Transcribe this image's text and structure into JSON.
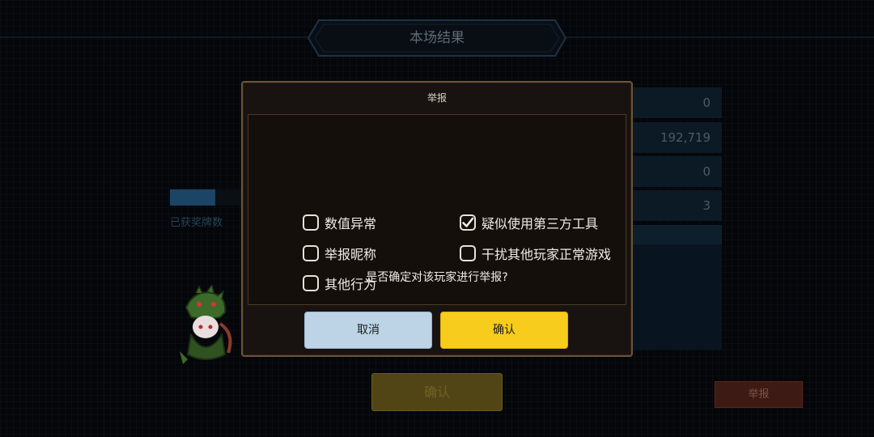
{
  "header": {
    "title": "本场结果"
  },
  "stats": {
    "values": [
      "0",
      "192,719",
      "0",
      "3"
    ]
  },
  "medals": {
    "label": "已获奖牌数",
    "progress": 0.62
  },
  "background_buttons": {
    "confirm_label": "确认",
    "report_label": "举报"
  },
  "dialog": {
    "title": "举报",
    "options": [
      {
        "label": "数值异常",
        "checked": false
      },
      {
        "label": "疑似使用第三方工具",
        "checked": true
      },
      {
        "label": "举报昵称",
        "checked": false
      },
      {
        "label": "干扰其他玩家正常游戏",
        "checked": false
      },
      {
        "label": "其他行为",
        "checked": false
      }
    ],
    "question": "是否确定对该玩家进行举报?",
    "cancel_label": "取消",
    "confirm_label": "确认"
  },
  "colors": {
    "confirm": "#f8cc1c",
    "cancel": "#bcd4e6",
    "report": "#3d1a14"
  },
  "icons": {
    "checked": "checkmark-icon"
  }
}
